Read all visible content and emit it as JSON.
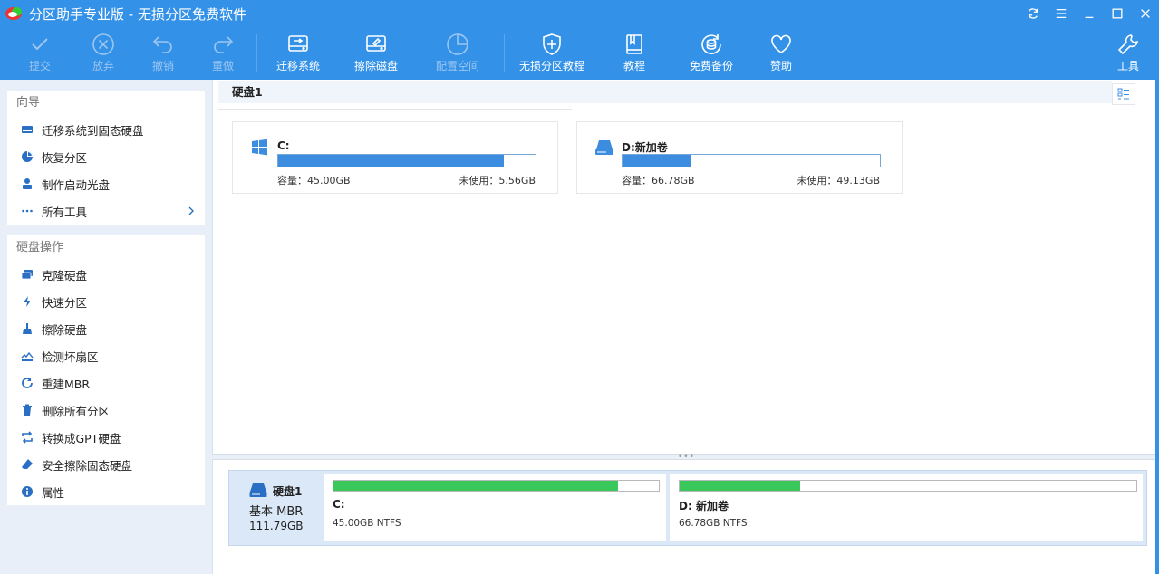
{
  "window": {
    "title": "分区助手专业版 - 无损分区免费软件",
    "colors": {
      "primary": "#3391e8",
      "partition_blue": "#3c8de0",
      "partition_green": "#3ac85c"
    }
  },
  "toolbar": {
    "commit": "提交",
    "discard": "放弃",
    "undo": "撤销",
    "redo": "重做",
    "migrate": "迁移系统",
    "wipe": "擦除磁盘",
    "allocate": "配置空间",
    "tutorial_lossless": "无损分区教程",
    "tutorial": "教程",
    "backup": "免费备份",
    "donate": "赞助",
    "tools": "工具"
  },
  "sidebar": {
    "wizard_title": "向导",
    "wizard_items": [
      {
        "label": "迁移系统到固态硬盘",
        "icon": "disk-migrate-icon"
      },
      {
        "label": "恢复分区",
        "icon": "pie-chart-icon"
      },
      {
        "label": "制作启动光盘",
        "icon": "user-disc-icon"
      },
      {
        "label": "所有工具",
        "icon": "dots-icon"
      }
    ],
    "disk_ops_title": "硬盘操作",
    "disk_ops_items": [
      {
        "label": "克隆硬盘",
        "icon": "clone-disk-icon"
      },
      {
        "label": "快速分区",
        "icon": "lightning-icon"
      },
      {
        "label": "擦除硬盘",
        "icon": "broom-icon"
      },
      {
        "label": "检测坏扇区",
        "icon": "scan-disk-icon"
      },
      {
        "label": "重建MBR",
        "icon": "rebuild-icon"
      },
      {
        "label": "删除所有分区",
        "icon": "trash-icon"
      },
      {
        "label": "转换成GPT硬盘",
        "icon": "convert-icon"
      },
      {
        "label": "安全擦除固态硬盘",
        "icon": "eraser-icon"
      },
      {
        "label": "属性",
        "icon": "info-icon"
      }
    ]
  },
  "main": {
    "disk_header": "硬盘1",
    "partitions": [
      {
        "name": "C:",
        "capacity": "容量：45.00GB",
        "free": "未使用：5.56GB",
        "used_fraction": 0.876
      },
      {
        "name": "D:新加卷",
        "capacity": "容量：66.78GB",
        "free": "未使用：49.13GB",
        "used_fraction": 0.264
      }
    ]
  },
  "disk_map": {
    "name": "硬盘1",
    "type": "基本 MBR",
    "size": "111.79GB",
    "partitions": [
      {
        "name": "C:",
        "info": "45.00GB NTFS",
        "used_fraction": 0.876
      },
      {
        "name": "D: 新加卷",
        "info": "66.78GB NTFS",
        "used_fraction": 0.264
      }
    ]
  }
}
